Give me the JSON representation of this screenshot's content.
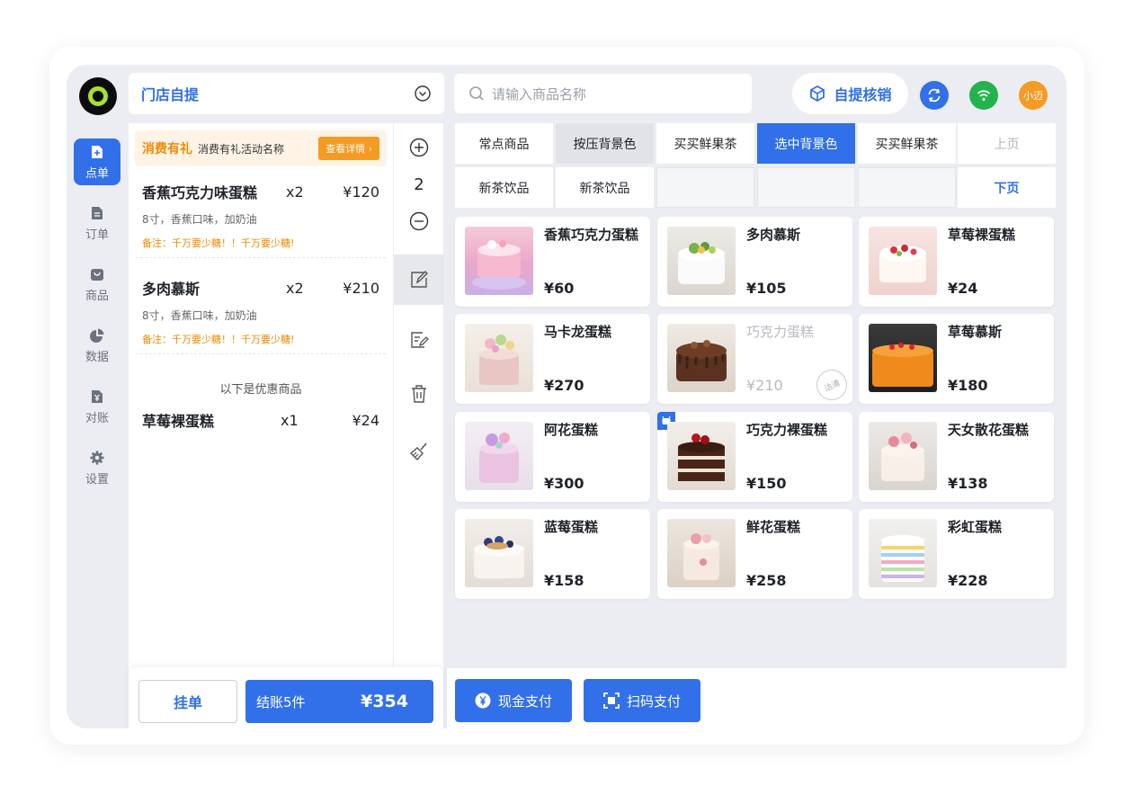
{
  "header": {
    "store_label": "门店自提",
    "search_placeholder": "请输入商品名称",
    "pickup_verify": "自提核销",
    "user_label": "小迈",
    "colors": {
      "accent": "#3170e8",
      "refresh": "#3170e8",
      "wifi": "#22b34c",
      "avatar": "#f59a23"
    }
  },
  "sidebar": {
    "items": [
      {
        "label": "点单",
        "icon": "order-add-icon",
        "active": true
      },
      {
        "label": "订单",
        "icon": "document-icon"
      },
      {
        "label": "商品",
        "icon": "shopping-bag-icon"
      },
      {
        "label": "数据",
        "icon": "pie-chart-icon"
      },
      {
        "label": "对账",
        "icon": "yen-document-icon"
      },
      {
        "label": "设置",
        "icon": "gear-icon"
      }
    ]
  },
  "promo": {
    "title": "消费有礼",
    "desc": "消费有礼活动名称",
    "button": "查看详情"
  },
  "order_items": [
    {
      "name": "香蕉巧克力味蛋糕",
      "qty": "x2",
      "price": "¥120",
      "spec": "8寸，香蕉口味，加奶油",
      "remark": "备注：千万要少糖！！千万要少糖!"
    },
    {
      "name": "多肉慕斯",
      "qty": "x2",
      "price": "¥210",
      "spec": "8寸，香蕉口味，加奶油",
      "remark": "备注：千万要少糖！！千万要少糖!"
    }
  ],
  "discount": {
    "title": "以下是优惠商品",
    "item": {
      "name": "草莓裸蛋糕",
      "qty": "x1",
      "price": "¥24"
    }
  },
  "tools": {
    "count": "2"
  },
  "footer": {
    "hold": "挂单",
    "checkout": "结账5件",
    "total": "¥354",
    "cash": "现金支付",
    "scan": "扫码支付"
  },
  "categories": {
    "row1": [
      "常点商品",
      "按压背景色",
      "买买鲜果茶",
      "选中背景色",
      "买买鲜果茶",
      "上页"
    ],
    "row2": [
      "新茶饮品",
      "新茶饮品",
      "",
      "",
      "",
      "下页"
    ]
  },
  "products": [
    {
      "name": "香蕉巧克力蛋糕",
      "price": "¥60"
    },
    {
      "name": "多肉慕斯",
      "price": "¥105"
    },
    {
      "name": "草莓裸蛋糕",
      "price": "¥24"
    },
    {
      "name": "马卡龙蛋糕",
      "price": "¥270"
    },
    {
      "name": "巧克力蛋糕",
      "price": "¥210",
      "badge": "沽清"
    },
    {
      "name": "草莓慕斯",
      "price": "¥180"
    },
    {
      "name": "阿花蛋糕",
      "price": "¥300"
    },
    {
      "name": "巧克力裸蛋糕",
      "price": "¥150"
    },
    {
      "name": "天女散花蛋糕",
      "price": "¥138"
    },
    {
      "name": "蓝莓蛋糕",
      "price": "¥158"
    },
    {
      "name": "鲜花蛋糕",
      "price": "¥258"
    },
    {
      "name": "彩虹蛋糕",
      "price": "¥228"
    }
  ]
}
